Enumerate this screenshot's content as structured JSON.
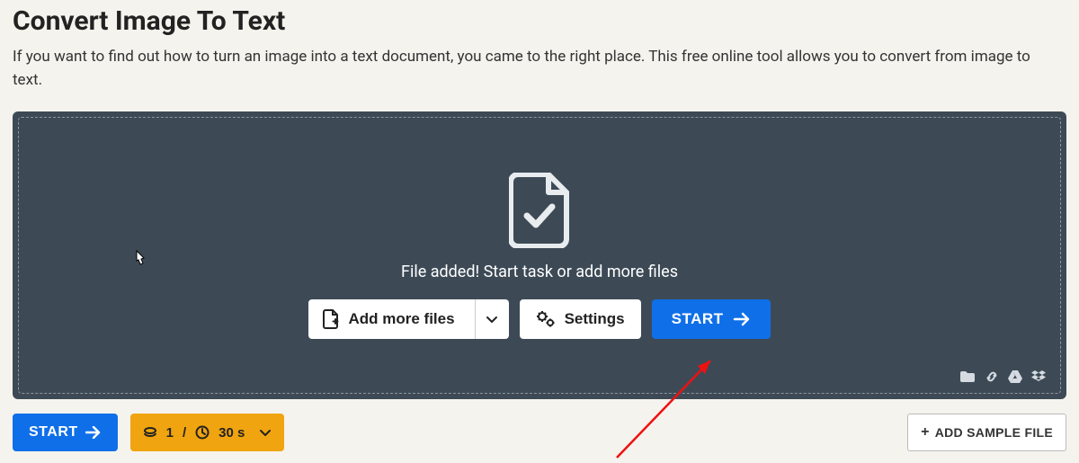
{
  "header": {
    "title": "Convert Image To Text",
    "subtitle": "If you want to find out how to turn an image into a text document, you came to the right place. This free online tool allows you to convert from image to text."
  },
  "dropzone": {
    "status_text": "File added! Start task or add more files",
    "add_more_label": "Add more files",
    "settings_label": "Settings",
    "start_label": "START"
  },
  "bottom": {
    "start_label": "START",
    "queue_count": "1",
    "queue_sep": "/",
    "time_value": "30 s",
    "add_sample_label": "ADD SAMPLE FILE"
  }
}
